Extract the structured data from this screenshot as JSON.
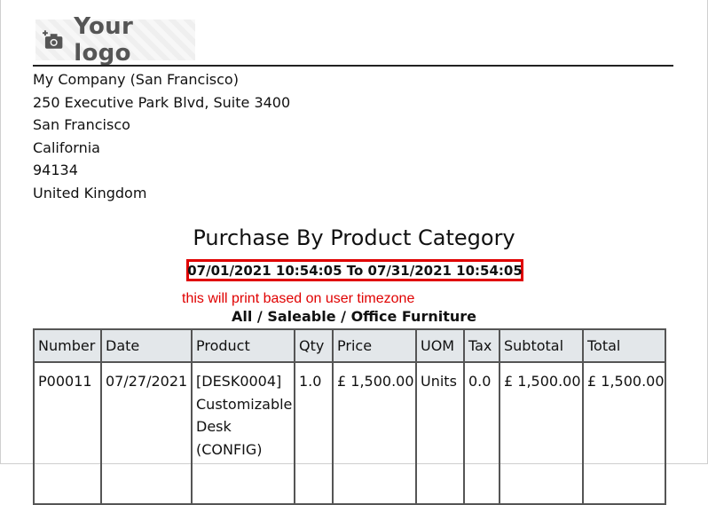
{
  "logo": {
    "text": "Your logo",
    "icon": "camera-plus-icon"
  },
  "company": {
    "lines": [
      "My Company (San Francisco)",
      "250 Executive Park Blvd, Suite 3400",
      "San Francisco",
      "California",
      "94134",
      "United Kingdom"
    ]
  },
  "report": {
    "title": "Purchase By Product Category",
    "date_range": "07/01/2021 10:54:05 To 07/31/2021 10:54:05",
    "timezone_note": "this will print based on user timezone",
    "category": "All / Saleable / Office Furniture"
  },
  "colors": {
    "annotation": "#e00000",
    "header_bg": "#e3e7ea"
  },
  "table": {
    "headers": [
      "Number",
      "Date",
      "Product",
      "Qty",
      "Price",
      "UOM",
      "Tax",
      "Subtotal",
      "Total"
    ],
    "rows": [
      {
        "number": "P00011",
        "date": "07/27/2021",
        "product_lines": [
          "[DESK0004]",
          "Customizable",
          "Desk",
          "(CONFIG)"
        ],
        "qty": "1.0",
        "price": "£ 1,500.00",
        "uom": "Units",
        "tax": "0.0",
        "subtotal": "£ 1,500.00",
        "total": "£ 1,500.00"
      }
    ]
  }
}
